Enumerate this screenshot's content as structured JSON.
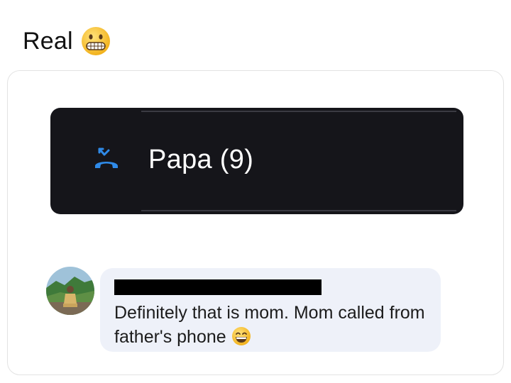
{
  "heading": {
    "text": "Real",
    "emoji": "grimacing-face-icon"
  },
  "call_log": {
    "icon": "missed-call-icon",
    "name": "Papa (9)",
    "accent_color": "#2f8ae8"
  },
  "comment": {
    "author": "[redacted]",
    "avatar": "avatar",
    "text": "Definitely that is mom. Mom called from father's phone",
    "emoji": "grinning-face-icon"
  }
}
